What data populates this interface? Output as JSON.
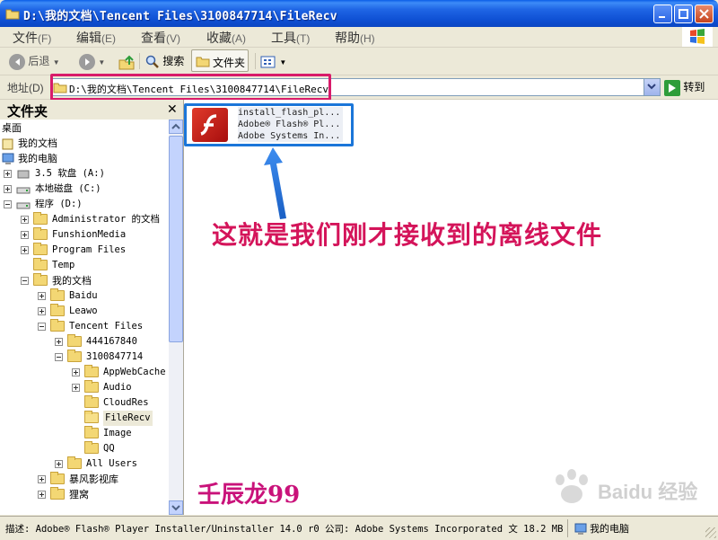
{
  "window": {
    "title": "D:\\我的文档\\Tencent Files\\3100847714\\FileRecv"
  },
  "menu": [
    {
      "label": "文件",
      "acc": "(F)"
    },
    {
      "label": "编辑",
      "acc": "(E)"
    },
    {
      "label": "查看",
      "acc": "(V)"
    },
    {
      "label": "收藏",
      "acc": "(A)"
    },
    {
      "label": "工具",
      "acc": "(T)"
    },
    {
      "label": "帮助",
      "acc": "(H)"
    }
  ],
  "toolbar": {
    "back": "后退",
    "search": "搜索",
    "folders": "文件夹"
  },
  "address": {
    "label": "地址(D)",
    "value": "D:\\我的文档\\Tencent Files\\3100847714\\FileRecv",
    "go": "转到"
  },
  "folder_pane": {
    "title": "文件夹",
    "tree": [
      {
        "label": "桌面"
      },
      {
        "label": "我的文档"
      },
      {
        "label": "我的电脑"
      },
      {
        "label": "3.5 软盘 (A:)"
      },
      {
        "label": "本地磁盘 (C:)"
      },
      {
        "label": "程序 (D:)"
      },
      {
        "label": "Administrator 的文档"
      },
      {
        "label": "FunshionMedia"
      },
      {
        "label": "Program Files"
      },
      {
        "label": "Temp"
      },
      {
        "label": "我的文档"
      },
      {
        "label": "Baidu"
      },
      {
        "label": "Leawo"
      },
      {
        "label": "Tencent Files"
      },
      {
        "label": "444167840"
      },
      {
        "label": "3100847714"
      },
      {
        "label": "AppWebCache"
      },
      {
        "label": "Audio"
      },
      {
        "label": "CloudRes"
      },
      {
        "label": "FileRecv"
      },
      {
        "label": "Image"
      },
      {
        "label": "QQ"
      },
      {
        "label": "All Users"
      },
      {
        "label": "暴风影视库"
      },
      {
        "label": "狸窝"
      }
    ]
  },
  "file": {
    "name": "install_flash_pl...",
    "description": "Adobe® Flash® Pl...",
    "company": "Adobe Systems In..."
  },
  "annotation": "这就是我们刚才接收到的离线文件",
  "author": "壬辰龙99",
  "watermark": "Baidu 经验",
  "status": {
    "text": "描述: Adobe® Flash® Player Installer/Uninstaller 14.0 r0 公司: Adobe Systems Incorporated 文 18.2 MB",
    "zone": "我的电脑"
  },
  "colors": {
    "annotation": "#d4145a",
    "address_highlight": "#d81b6a",
    "file_highlight": "#1b76d9"
  }
}
